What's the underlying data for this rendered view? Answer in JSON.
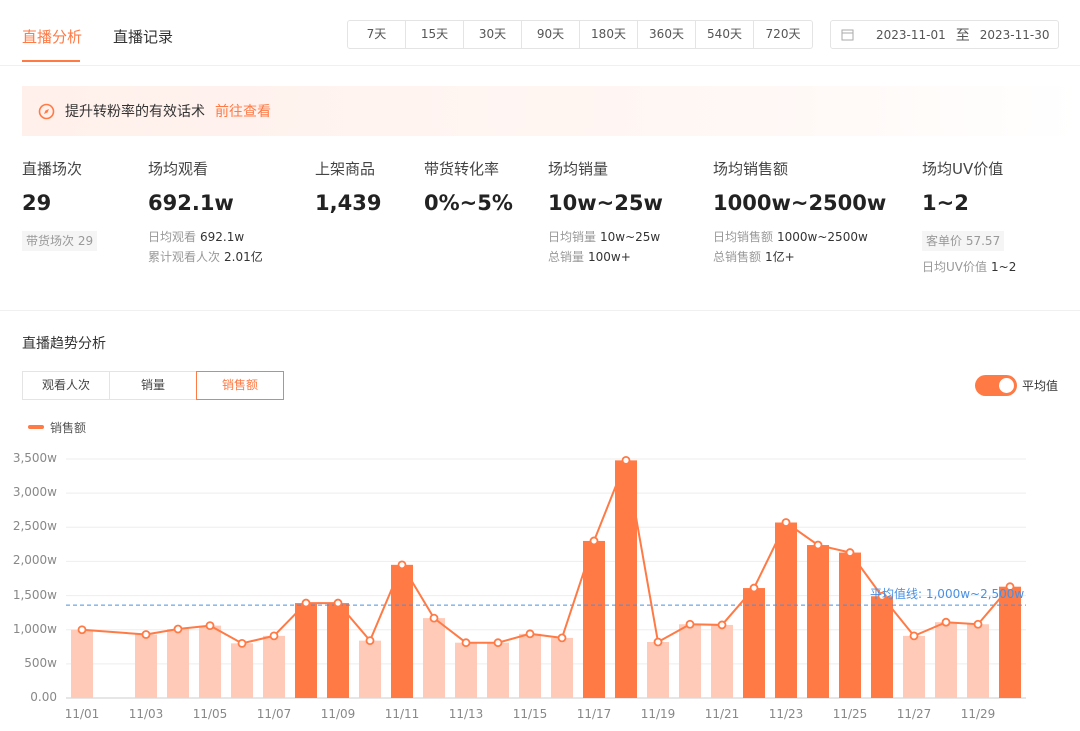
{
  "tabs": [
    {
      "label": "直播分析"
    },
    {
      "label": "直播记录"
    }
  ],
  "periods": [
    "7天",
    "15天",
    "30天",
    "90天",
    "180天",
    "360天",
    "540天",
    "720天"
  ],
  "date_range": {
    "start": "2023-11-01",
    "sep": "至",
    "end": "2023-11-30"
  },
  "banner": {
    "text": "提升转粉率的有效话术",
    "link": "前往查看"
  },
  "stats": [
    {
      "label": "直播场次",
      "value": "29",
      "chip_label": "带货场次",
      "chip_value": "29"
    },
    {
      "label": "场均观看",
      "value": "692.1w",
      "subs": [
        {
          "k": "日均观看",
          "v": "692.1w"
        },
        {
          "k": "累计观看人次",
          "v": "2.01亿"
        }
      ]
    },
    {
      "label": "上架商品",
      "value": "1,439"
    },
    {
      "label": "带货转化率",
      "value": "0%~5%"
    },
    {
      "label": "场均销量",
      "value": "10w~25w",
      "subs": [
        {
          "k": "日均销量",
          "v": "10w~25w"
        },
        {
          "k": "总销量",
          "v": "100w+"
        }
      ]
    },
    {
      "label": "场均销售额",
      "value": "1000w~2500w",
      "subs": [
        {
          "k": "日均销售额",
          "v": "1000w~2500w"
        },
        {
          "k": "总销售额",
          "v": "1亿+"
        }
      ]
    },
    {
      "label": "场均UV价值",
      "value": "1~2",
      "chip_label": "客单价",
      "chip_value": "57.57",
      "subs": [
        {
          "k": "日均UV价值",
          "v": "1~2"
        }
      ]
    }
  ],
  "trend": {
    "title": "直播趋势分析",
    "segments": [
      "观看人次",
      "销量",
      "销售额"
    ],
    "active_segment": 2,
    "toggle_label": "平均值",
    "toggle_on": true
  },
  "colors": {
    "accent": "#ff7a45",
    "light_bar": "#ffcab8",
    "avg_line": "#4a90e2"
  },
  "chart_data": {
    "type": "bar",
    "legend": [
      "销售额"
    ],
    "legend_placement": "top-left",
    "categories": [
      "11/01",
      "11/02",
      "11/03",
      "11/04",
      "11/05",
      "11/06",
      "11/07",
      "11/08",
      "11/09",
      "11/10",
      "11/11",
      "11/12",
      "11/13",
      "11/14",
      "11/15",
      "11/16",
      "11/17",
      "11/18",
      "11/19",
      "11/20",
      "11/21",
      "11/22",
      "11/23",
      "11/24",
      "11/25",
      "11/26",
      "11/27",
      "11/28",
      "11/29",
      "11/30"
    ],
    "values": [
      1000,
      null,
      930,
      1010,
      1060,
      800,
      910,
      1390,
      1390,
      840,
      1950,
      1170,
      810,
      810,
      940,
      880,
      2300,
      3480,
      820,
      1080,
      1070,
      1610,
      2570,
      2240,
      2130,
      1490,
      910,
      1110,
      1080,
      1630
    ],
    "x_tick_labels": [
      "11/01",
      "11/03",
      "11/05",
      "11/07",
      "11/09",
      "11/11",
      "11/13",
      "11/15",
      "11/17",
      "11/19",
      "11/21",
      "11/23",
      "11/25",
      "11/27",
      "11/29"
    ],
    "y_tick_labels": [
      "0.00",
      "500w",
      "1,000w",
      "1,500w",
      "2,000w",
      "2,500w",
      "3,000w",
      "3,500w"
    ],
    "ylim": [
      0,
      3500
    ],
    "average": 1360,
    "average_label": "平均值线: 1,000w~2,500w",
    "grid": true
  }
}
